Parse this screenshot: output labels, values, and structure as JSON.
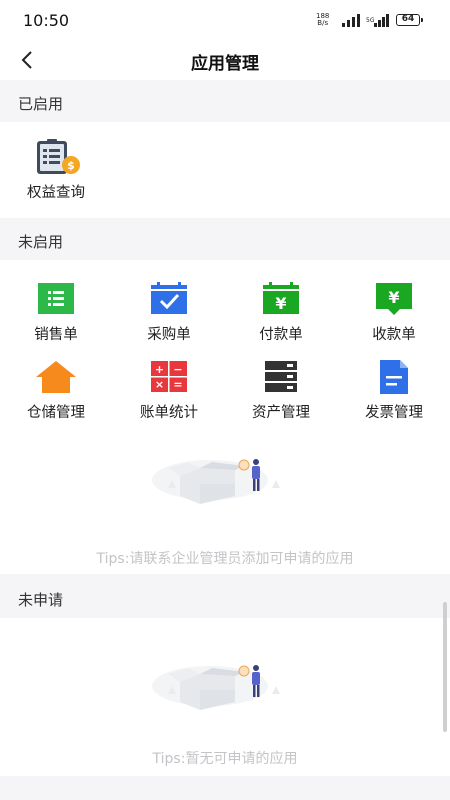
{
  "status_bar": {
    "time": "10:50",
    "net_speed_value": "188",
    "net_speed_unit": "B/s",
    "battery": "64"
  },
  "navbar": {
    "title": "应用管理"
  },
  "sections": {
    "enabled": {
      "header": "已启用",
      "apps": [
        {
          "label": "权益查询",
          "icon": "benefits-query-icon"
        }
      ]
    },
    "not_enabled": {
      "header": "未启用",
      "apps": [
        {
          "label": "销售单",
          "icon": "sales-order-icon",
          "color": "#2db84a"
        },
        {
          "label": "采购单",
          "icon": "purchase-order-icon",
          "color": "#2f6fe8"
        },
        {
          "label": "付款单",
          "icon": "payment-order-icon",
          "color": "#1aa722"
        },
        {
          "label": "收款单",
          "icon": "receipt-order-icon",
          "color": "#1aa722"
        },
        {
          "label": "仓储管理",
          "icon": "warehouse-icon",
          "color": "#f78a1d"
        },
        {
          "label": "账单统计",
          "icon": "bill-statistics-icon",
          "color": "#e8383d"
        },
        {
          "label": "资产管理",
          "icon": "asset-management-icon",
          "color": "#333333"
        },
        {
          "label": "发票管理",
          "icon": "invoice-management-icon",
          "color": "#2f6fe8"
        }
      ],
      "tips": "Tips:请联系企业管理员添加可申请的应用"
    },
    "not_applied": {
      "header": "未申请",
      "tips": "Tips:暂无可申请的应用"
    }
  }
}
